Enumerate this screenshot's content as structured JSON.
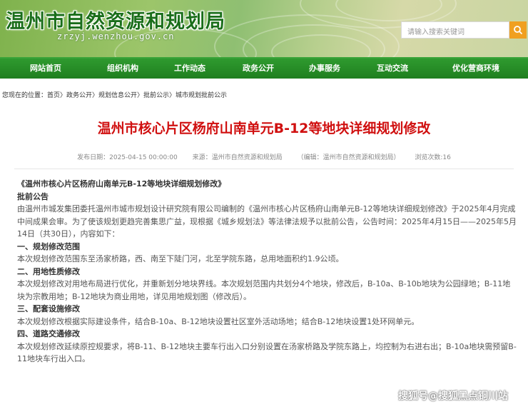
{
  "header": {
    "site_title": "温州市自然资源和规划局",
    "site_url": "zrzyj.wenzhou.gov.cn",
    "search_placeholder": "请输入搜索关键词"
  },
  "nav": {
    "items": [
      "网站首页",
      "组织机构",
      "工作动态",
      "政务公开",
      "办事服务",
      "互动交流",
      "优化营商环境"
    ]
  },
  "breadcrumb": {
    "text": "您现在的位置：首页〉政务公开〉规划信息公开〉批前公示〉城市规划批前公示"
  },
  "article": {
    "title": "温州市核心片区杨府山南单元B-12等地块详细规划修改",
    "meta": {
      "published": "发布日期：2025-04-15 00:00:00",
      "source": "来源：温州市自然资源和规划局",
      "editor": "（编辑：温州市自然资源和规划局）",
      "views": "浏览次数:16"
    },
    "doc_title": "《温州市核心片区杨府山南单元B-12等地块详细规划修改》",
    "section_label": "批前公告",
    "intro": "由温州市城发集团委托温州市城市规划设计研究院有限公司编制的《温州市核心片区杨府山南单元B-12等地块详细规划修改》于2025年4月完成中间成果会审。为了使该规划更趋完善集思广益，现根据《城乡规划法》等法律法规予以批前公告，公告时间：2025年4月15日——2025年5月14日（共30日），内容如下：",
    "h1": "一、规划修改范围",
    "p1": "本次规划修改范围东至汤家桥路，西、南至下陡门河，北至学院东路，总用地面积约1.9公顷。",
    "h2": "二、用地性质修改",
    "p2": "本次规划修改对用地布局进行优化，并重新划分地块界线。本次规划范围内共划分4个地块，修改后，B-10a、B-10b地块为公园绿地；B-11地块为宗教用地；B-12地块为商业用地，详见用地规划图（修改后）。",
    "h3": "三、配套设施修改",
    "p3": "本次规划修改根据实际建设条件，结合B-10a、B-12地块设置社区室外活动场地；结合B-12地块设置1处环网单元。",
    "h4": "四、道路交通修改",
    "p4": "本次规划修改延续原控规要求，将B-11、B-12地块主要车行出入口分别设置在汤家桥路及学院东路上，均控制为右进右出；B-10a地块需预留B-11地块车行出入口。"
  },
  "watermark": "搜狐号@搜狐黑点铜川站"
}
